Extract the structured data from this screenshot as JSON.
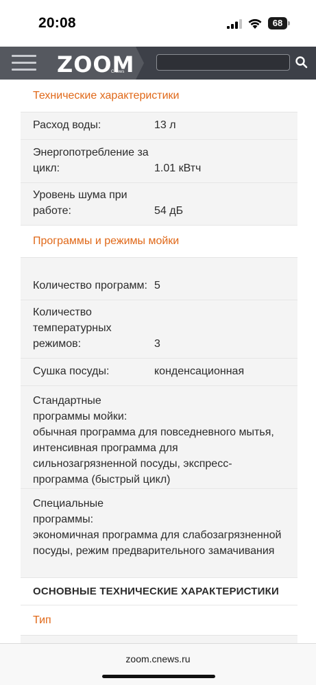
{
  "status_bar": {
    "time": "20:08",
    "battery": "68"
  },
  "header": {
    "logo": "ZOOM",
    "logo_sub": "CNews",
    "search_placeholder": "",
    "accent_color": "#e06818"
  },
  "sections": [
    {
      "title": "Технические характеристики",
      "rows": [
        {
          "key": "Расход воды:",
          "value": "13 л"
        },
        {
          "key": "Энергопотребление за цикл:",
          "value": "1.01 кВтч"
        },
        {
          "key": "Уровень шума при работе:",
          "value": "54 дБ"
        }
      ]
    },
    {
      "title": "Программы и режимы мойки",
      "rows": [
        {
          "key": "Количество программ:",
          "value": "5"
        },
        {
          "key": "Количество температурных режимов:",
          "value": "3"
        },
        {
          "key": "Сушка посуды:",
          "value": "конденсационная"
        },
        {
          "key": "Стандартные программы мойки:",
          "value": "обычная программа для повседневного мытья, интенсивная программа для сильнозагрязненной посуды, экспресс-программа (быстрый цикл)"
        },
        {
          "key": "Специальные программы:",
          "value": "экономичная программа для слабозагрязненной посуды, режим предварительного замачивания"
        }
      ]
    }
  ],
  "main_heading": "ОСНОВНЫЕ ТЕХНИЧЕСКИЕ ХАРАКТЕРИСТИКИ",
  "type_heading": "Тип",
  "url_bar": {
    "url": "zoom.cnews.ru"
  }
}
